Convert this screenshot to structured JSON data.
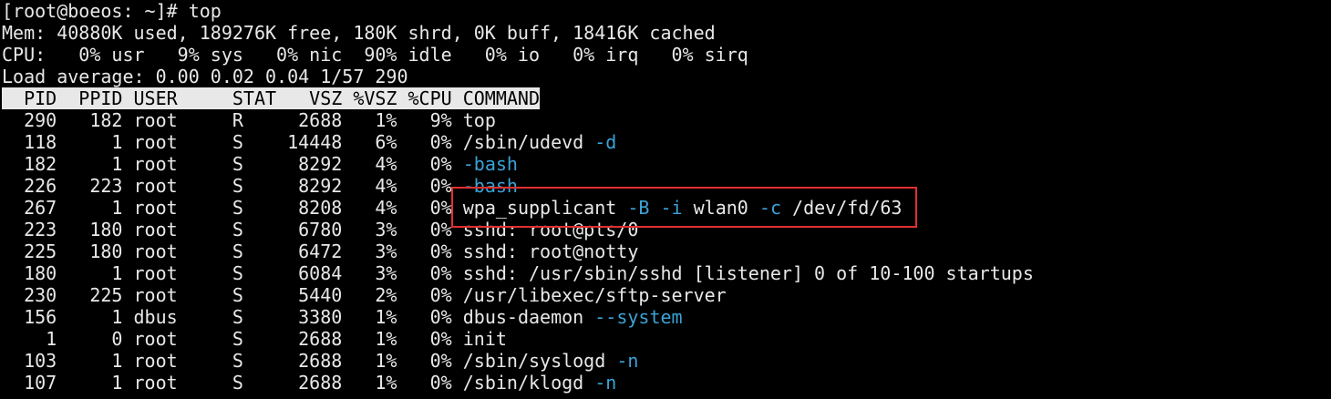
{
  "prompt_line": "[root@boeos: ~]# top",
  "mem_line": "Mem: 40880K used, 189276K free, 180K shrd, 0K buff, 18416K cached",
  "cpu_line": "CPU:   0% usr   9% sys   0% nic  90% idle   0% io   0% irq   0% sirq",
  "load_line": "Load average: 0.00 0.02 0.04 1/57 290",
  "header": "  PID  PPID USER     STAT   VSZ %VSZ %CPU COMMAND",
  "processes": [
    {
      "row": "  290   182 root     R     2688   1%   9% ",
      "cmd": "top",
      "args": ""
    },
    {
      "row": "  118     1 root     S    14448   6%   0% ",
      "cmd": "/sbin/udevd ",
      "args": "-d"
    },
    {
      "row": "  182     1 root     S     8292   4%   0% ",
      "cmd": "",
      "args": "-bash"
    },
    {
      "row": "  226   223 root     S     8292   4%   0% ",
      "cmd": "",
      "args": "-bash"
    },
    {
      "row": "  267     1 root     S     8208   4%   0% ",
      "cmd": "wpa_supplicant ",
      "args": "-B -i wlan0 -c /dev/fd/63"
    },
    {
      "row": "  223   180 root     S     6780   3%   0% ",
      "cmd": "sshd: root@pts/0",
      "args": ""
    },
    {
      "row": "  225   180 root     S     6472   3%   0% ",
      "cmd": "sshd: root@notty",
      "args": ""
    },
    {
      "row": "  180     1 root     S     6084   3%   0% ",
      "cmd": "sshd: /usr/sbin/sshd [listener] 0 of 10-100 startups",
      "args": ""
    },
    {
      "row": "  230   225 root     S     5440   2%   0% ",
      "cmd": "/usr/libexec/sftp-server",
      "args": ""
    },
    {
      "row": "  156     1 dbus     S     3380   1%   0% ",
      "cmd": "dbus-daemon ",
      "args": "--system"
    },
    {
      "row": "    1     0 root     S     2688   1%   0% ",
      "cmd": "init",
      "args": ""
    },
    {
      "row": "  103     1 root     S     2688   1%   0% ",
      "cmd": "/sbin/syslogd ",
      "args": "-n"
    },
    {
      "row": "  107     1 root     S     2688   1%   0% ",
      "cmd": "/sbin/klogd ",
      "args": "-n"
    }
  ],
  "colors": {
    "background": "#000000",
    "text": "#e8e8e8",
    "flag": "#3aa3d8",
    "highlight": "#e03030"
  }
}
